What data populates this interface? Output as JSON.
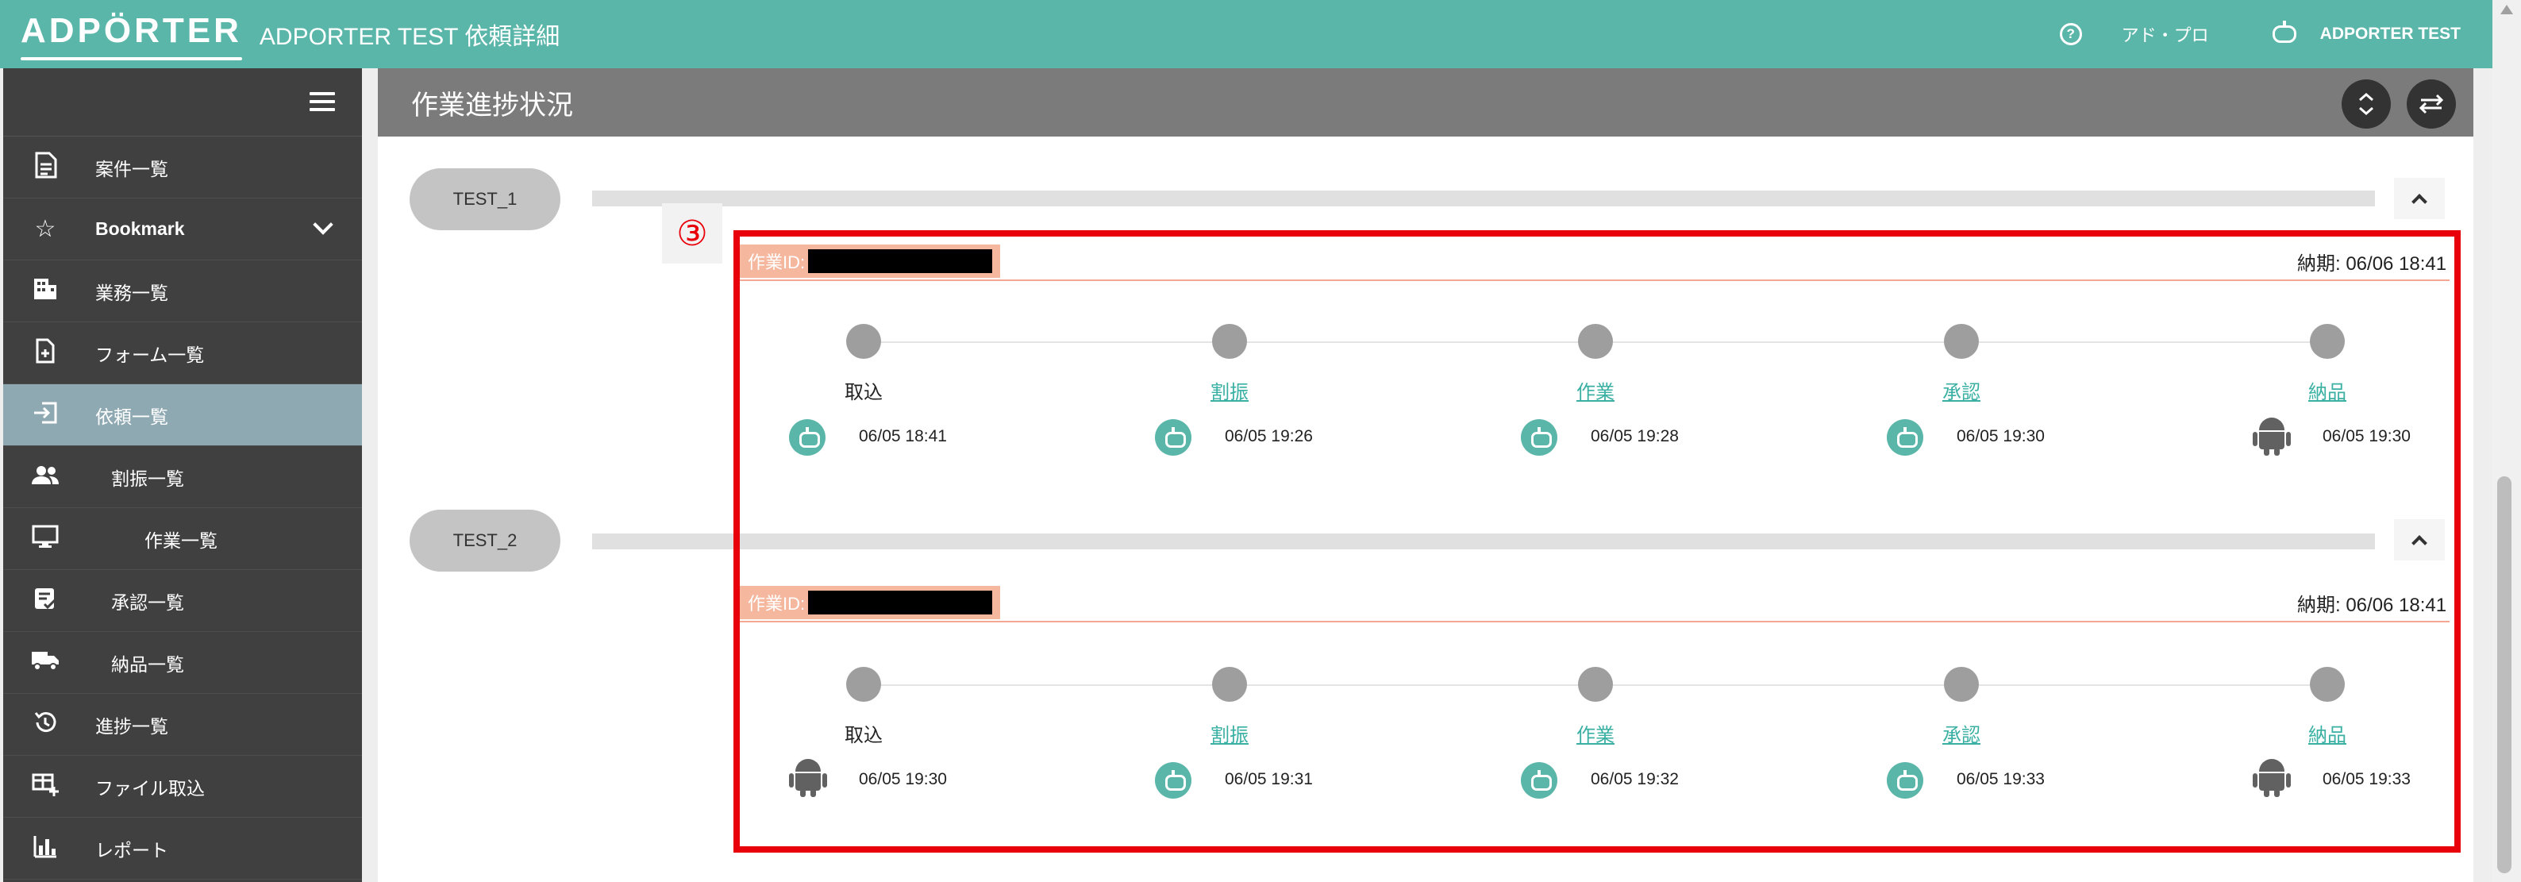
{
  "header": {
    "logo": "ADPÖRTER",
    "title": "ADPORTER TEST 依頼詳細",
    "help_icon": "question-circle-icon",
    "user_role": "アド・プロ",
    "user_icon": "robot-icon",
    "user_name": "ADPORTER TEST",
    "bg_color": "#5bb6aa"
  },
  "sidebar": {
    "items": [
      {
        "label": "案件一覧",
        "icon": "document-icon"
      },
      {
        "label": "Bookmark",
        "icon": "star-icon"
      },
      {
        "label": "業務一覧",
        "icon": "building-icon"
      },
      {
        "label": "フォーム一覧",
        "icon": "file-add-icon"
      },
      {
        "label": "依頼一覧",
        "icon": "login-icon"
      },
      {
        "label": "割振一覧",
        "icon": "people-icon"
      },
      {
        "label": "作業一覧",
        "icon": "monitor-icon"
      },
      {
        "label": "承認一覧",
        "icon": "checklist-icon"
      },
      {
        "label": "納品一覧",
        "icon": "truck-icon"
      },
      {
        "label": "進捗一覧",
        "icon": "history-icon"
      },
      {
        "label": "ファイル取込",
        "icon": "table-add-icon"
      },
      {
        "label": "レポート",
        "icon": "bar-chart-icon"
      }
    ],
    "active_index": 4
  },
  "panel": {
    "title": "作業進捗状況",
    "expand_icon": "unfold-icon",
    "swap_icon": "swap-icon"
  },
  "annotation": {
    "badge": "③",
    "color": "#e8000a"
  },
  "tasks": [
    {
      "name": "TEST_1",
      "id_label": "作業ID:",
      "due": "納期: 06/06 18:41",
      "steps": [
        {
          "label": "取込",
          "link": false,
          "actor": "robot",
          "time": "06/05 18:41"
        },
        {
          "label": "割振",
          "link": true,
          "actor": "robot",
          "time": "06/05 19:26"
        },
        {
          "label": "作業",
          "link": true,
          "actor": "robot",
          "time": "06/05 19:28"
        },
        {
          "label": "承認",
          "link": true,
          "actor": "robot",
          "time": "06/05 19:30"
        },
        {
          "label": "納品",
          "link": true,
          "actor": "android",
          "time": "06/05 19:30"
        }
      ]
    },
    {
      "name": "TEST_2",
      "id_label": "作業ID:",
      "due": "納期: 06/06 18:41",
      "steps": [
        {
          "label": "取込",
          "link": false,
          "actor": "android",
          "time": "06/05 19:30"
        },
        {
          "label": "割振",
          "link": true,
          "actor": "robot",
          "time": "06/05 19:31"
        },
        {
          "label": "作業",
          "link": true,
          "actor": "robot",
          "time": "06/05 19:32"
        },
        {
          "label": "承認",
          "link": true,
          "actor": "robot",
          "time": "06/05 19:33"
        },
        {
          "label": "納品",
          "link": true,
          "actor": "android",
          "time": "06/05 19:33"
        }
      ]
    }
  ]
}
